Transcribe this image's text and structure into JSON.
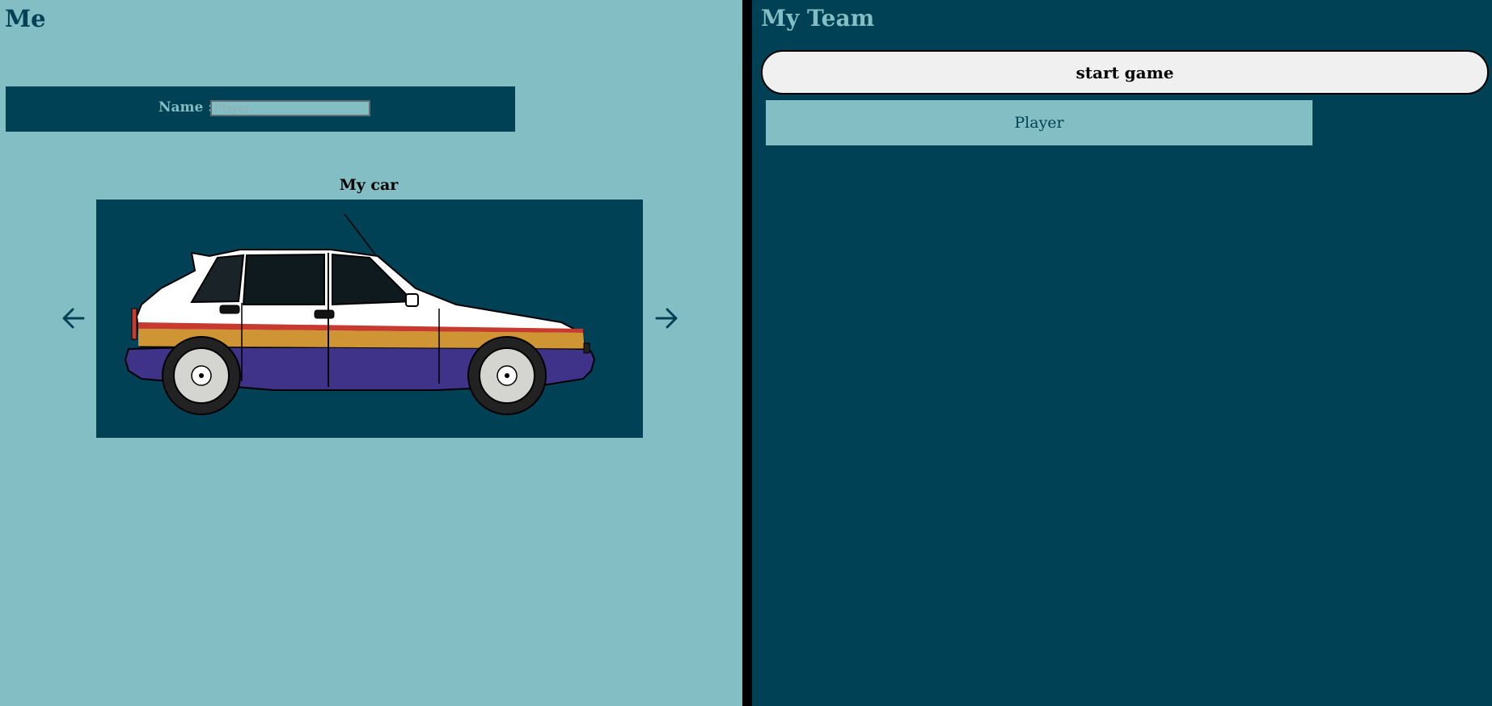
{
  "me": {
    "title": "Me",
    "name_label": "Name :",
    "name_placeholder": "Player",
    "name_value": ""
  },
  "car": {
    "title": "My car",
    "prev_icon": "arrow-left-icon",
    "next_icon": "arrow-right-icon",
    "image": "rally-hatchback-car",
    "colors": {
      "body": "#ffffff",
      "stripe_red": "#c73a2f",
      "stripe_gold": "#cf9433",
      "lower_body": "#3e3289"
    }
  },
  "team": {
    "title": "My Team",
    "start_label": "start game",
    "players": [
      "Player"
    ]
  },
  "colors": {
    "left_panel": "#82bec3",
    "right_panel": "#004155",
    "divider": "#000000"
  }
}
